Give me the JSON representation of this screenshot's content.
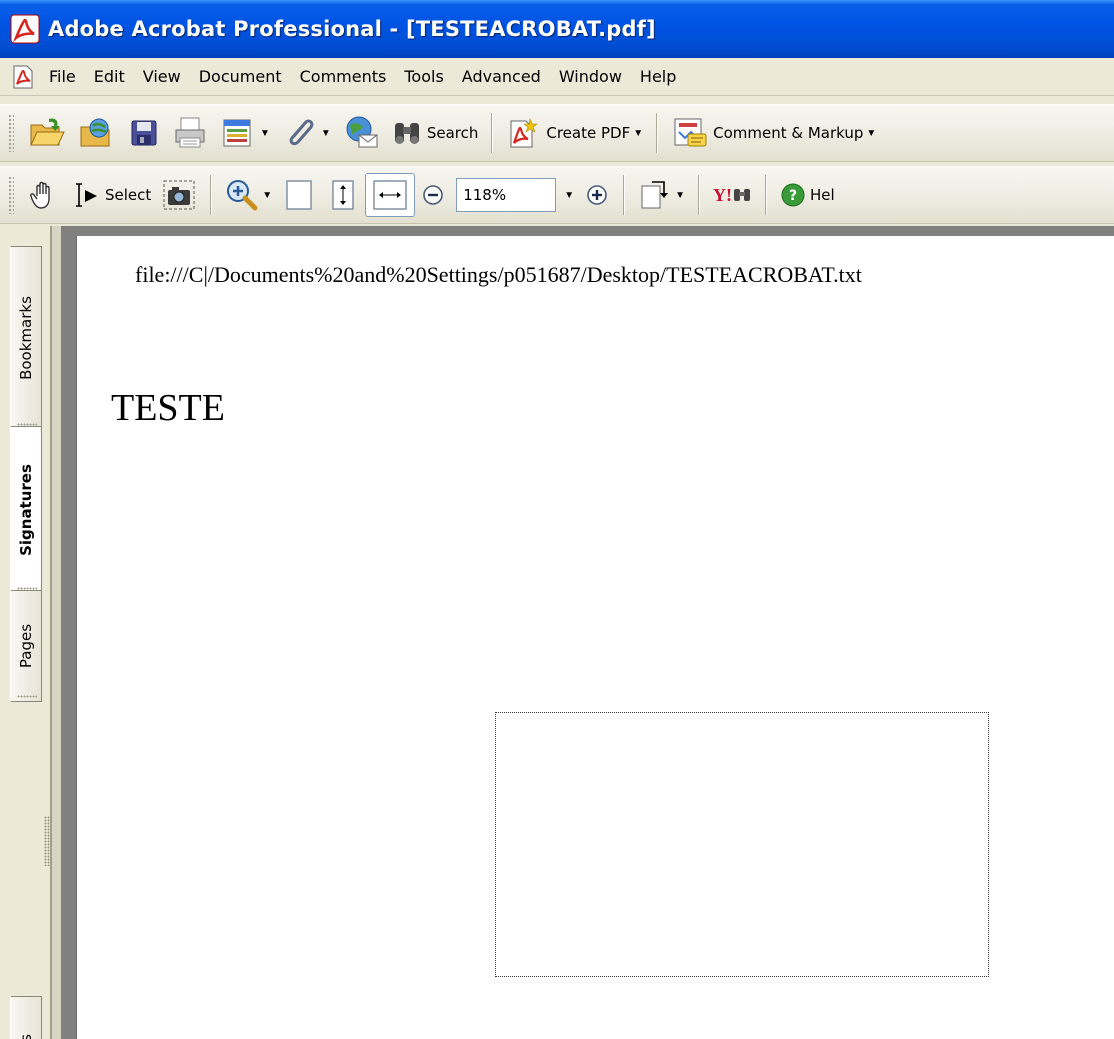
{
  "window": {
    "title": "Adobe Acrobat Professional - [TESTEACROBAT.pdf]"
  },
  "menu": {
    "items": [
      "File",
      "Edit",
      "View",
      "Document",
      "Comments",
      "Tools",
      "Advanced",
      "Window",
      "Help"
    ]
  },
  "toolbar1": {
    "search_label": "Search",
    "create_pdf_label": "Create PDF",
    "comment_markup_label": "Comment & Markup"
  },
  "toolbar2": {
    "select_label": "Select",
    "zoom_value": "118%",
    "help_label": "Hel",
    "yahoo_label": "Y!"
  },
  "nav": {
    "tabs": [
      "Bookmarks",
      "Signatures",
      "Pages"
    ],
    "active_tab": "Signatures",
    "partial_tab_glyph": "s"
  },
  "document": {
    "header_path": "file:///C|/Documents%20and%20Settings/p051687/Desktop/TESTEACROBAT.txt",
    "body_text": "TESTE"
  },
  "colors": {
    "titlebar": "#0054e3",
    "chrome": "#ece9d8",
    "doc_background": "#808080",
    "acrobat_red": "#d7261e"
  }
}
